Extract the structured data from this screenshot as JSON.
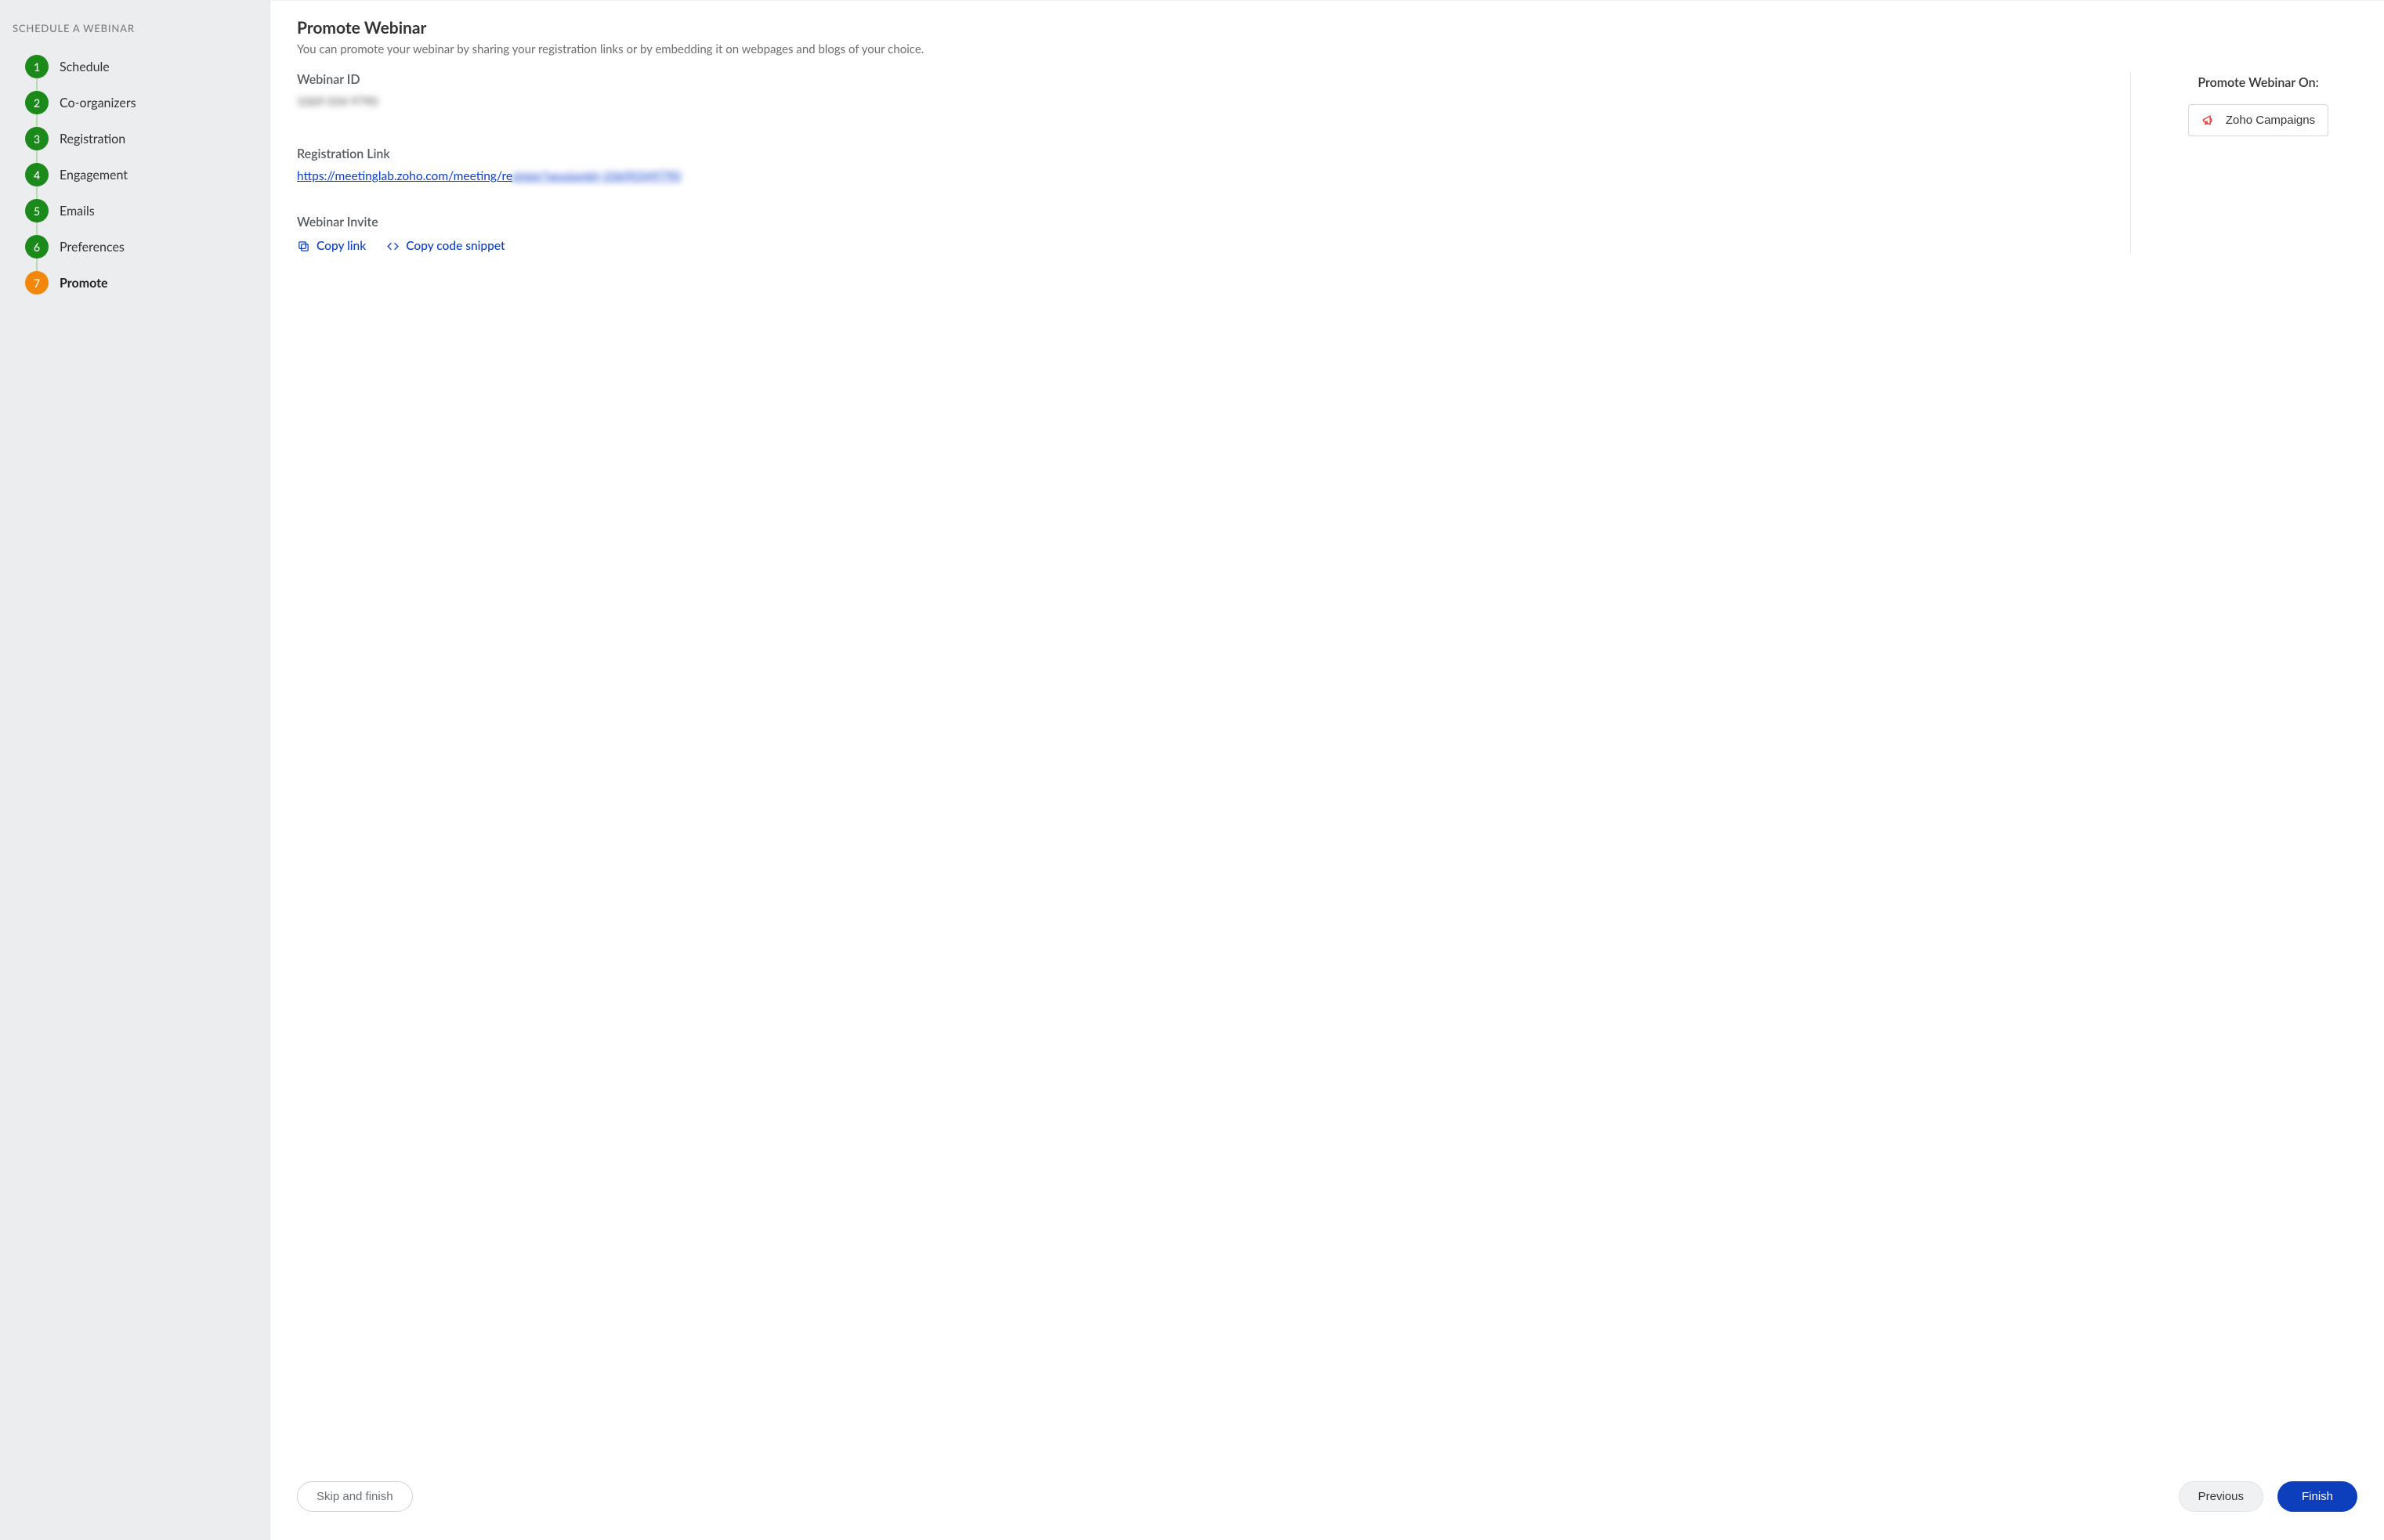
{
  "sidebar": {
    "title": "SCHEDULE A WEBINAR",
    "steps": [
      {
        "num": "1",
        "label": "Schedule",
        "state": "complete"
      },
      {
        "num": "2",
        "label": "Co-organizers",
        "state": "complete"
      },
      {
        "num": "3",
        "label": "Registration",
        "state": "complete"
      },
      {
        "num": "4",
        "label": "Engagement",
        "state": "complete"
      },
      {
        "num": "5",
        "label": "Emails",
        "state": "complete"
      },
      {
        "num": "6",
        "label": "Preferences",
        "state": "complete"
      },
      {
        "num": "7",
        "label": "Promote",
        "state": "active"
      }
    ]
  },
  "page": {
    "title": "Promote Webinar",
    "description": "You can promote your webinar by sharing your registration links or by embedding it on webpages and blogs of your choice.",
    "webinar_id_label": "Webinar ID",
    "webinar_id_value": "1069 034 9790",
    "registration_link_label": "Registration Link",
    "registration_link_visible": "https://meetinglab.zoho.com/meeting/re",
    "registration_link_redacted": "gister?sessionId=10690349790",
    "webinar_invite_label": "Webinar Invite",
    "copy_link_label": "Copy link",
    "copy_snippet_label": "Copy code snippet",
    "promote_on_label": "Promote Webinar On:",
    "promote_button_label": "Zoho Campaigns"
  },
  "footer": {
    "skip_label": "Skip and finish",
    "previous_label": "Previous",
    "finish_label": "Finish"
  },
  "colors": {
    "step_complete": "#1b8a1b",
    "step_active": "#f2870c",
    "primary": "#0d3fbd",
    "link": "#0b3ecf",
    "accent_red": "#e34a4a"
  }
}
